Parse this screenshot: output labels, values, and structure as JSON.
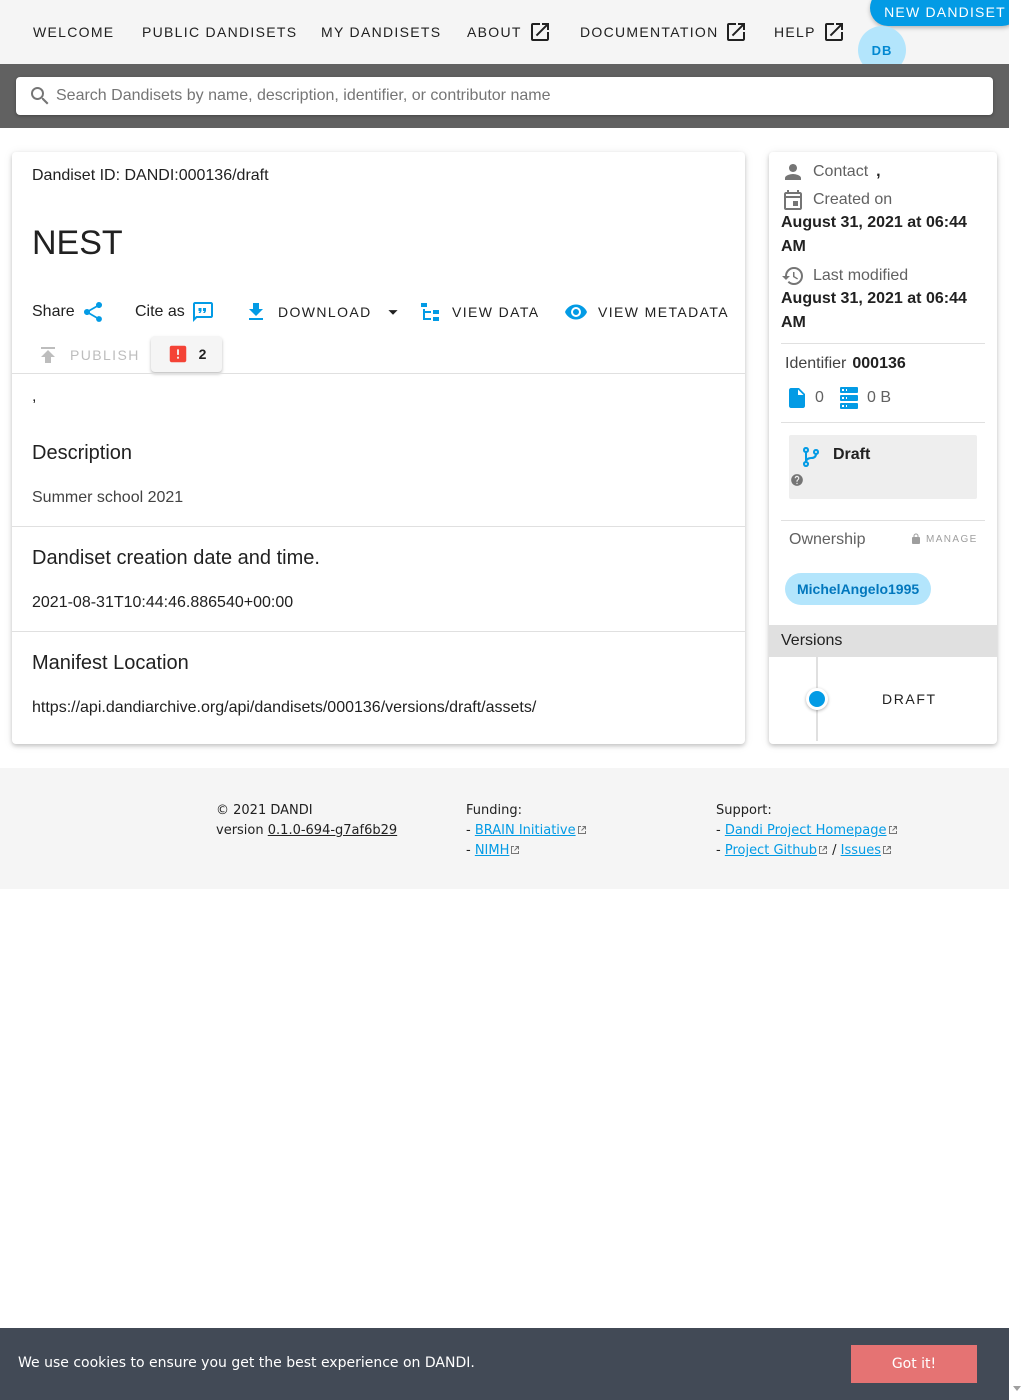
{
  "nav": {
    "items": [
      "Welcome",
      "Public Dandisets",
      "My Dandisets",
      "About",
      "Documentation",
      "Help"
    ],
    "new_dandiset": "New Dandiset",
    "avatar_initials": "DB"
  },
  "search": {
    "placeholder": "Search Dandisets by name, description, identifier, or contributor name"
  },
  "dandiset": {
    "id_line": "Dandiset ID: DANDI:000136/draft",
    "title": "NEST",
    "share_label": "Share",
    "cite_label": "Cite as",
    "download_label": "Download",
    "view_data_label": "View Data",
    "view_metadata_label": "View Metadata",
    "publish_label": "Publish",
    "error_count": "2",
    "contributors_text": ",",
    "description_heading": "Description",
    "description_text": "Summer school 2021",
    "creation_heading": "Dandiset creation date and time.",
    "creation_value": "2021-08-31T10:44:46.886540+00:00",
    "manifest_heading": "Manifest Location",
    "manifest_value": "https://api.dandiarchive.org/api/dandisets/000136/versions/draft/assets/"
  },
  "sidebar": {
    "contact_label": "Contact",
    "contact_value": ",",
    "created_label": "Created on",
    "created_value": "August 31, 2021 at 06:44 AM",
    "modified_label": "Last modified",
    "modified_value": "August 31, 2021 at 06:44 AM",
    "identifier_label": "Identifier",
    "identifier_value": "000136",
    "file_count": "0",
    "size": "0 B",
    "draft_label": "Draft",
    "ownership_label": "Ownership",
    "manage_label": "Manage",
    "owner": "MichelAngelo1995",
    "versions_heading": "Versions",
    "version_item": "Draft"
  },
  "footer": {
    "copyright": "© 2021 DANDI",
    "version_prefix": "version",
    "version": "0.1.0-694-g7af6b29",
    "funding_heading": "Funding:",
    "funding_links": [
      "BRAIN Initiative",
      "NIMH"
    ],
    "support_heading": "Support:",
    "support_links": [
      "Dandi Project Homepage",
      "Project Github",
      "Issues"
    ]
  },
  "cookie": {
    "text": "We use cookies to ensure you get the best experience on DANDI.",
    "button": "Got it!"
  },
  "colors": {
    "accent": "#039be5",
    "error": "#f44336",
    "cookie_bg": "#424a56",
    "cookie_button": "#e57373"
  }
}
